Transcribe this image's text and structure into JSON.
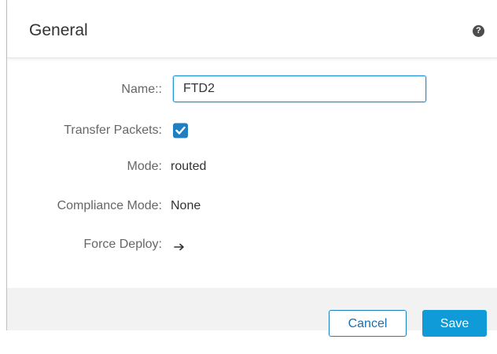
{
  "dialog": {
    "title": "General",
    "help_icon": "question-circle-icon",
    "help_glyph": "?"
  },
  "form": {
    "name": {
      "label": "Name::",
      "value": "FTD2"
    },
    "transfer_packets": {
      "label": "Transfer Packets:",
      "checked": true
    },
    "mode": {
      "label": "Mode:",
      "value": "routed"
    },
    "compliance_mode": {
      "label": "Compliance Mode:",
      "value": "None"
    },
    "force_deploy": {
      "label": "Force Deploy:",
      "icon": "arrow-right-icon"
    }
  },
  "footer": {
    "cancel_label": "Cancel",
    "save_label": "Save"
  },
  "colors": {
    "accent": "#0f9bd7",
    "checkbox": "#1f7fc0",
    "footer_bg": "#f2f2f2"
  }
}
